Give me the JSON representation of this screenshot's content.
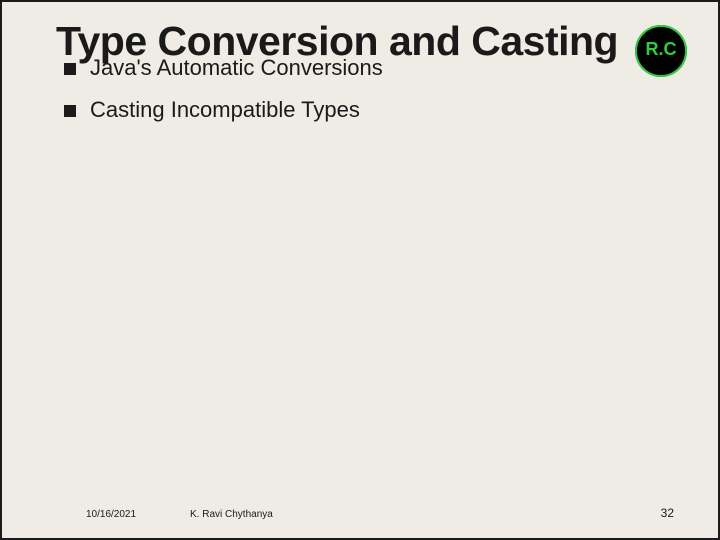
{
  "title": "Type Conversion and Casting",
  "bullets": [
    "Java's Automatic Conversions",
    "Casting Incompatible Types"
  ],
  "footer": {
    "date": "10/16/2021",
    "author": "K. Ravi Chythanya",
    "page": "32"
  },
  "logo": {
    "text": "R.C",
    "bg": "#000000",
    "fg": "#2ecc40"
  }
}
